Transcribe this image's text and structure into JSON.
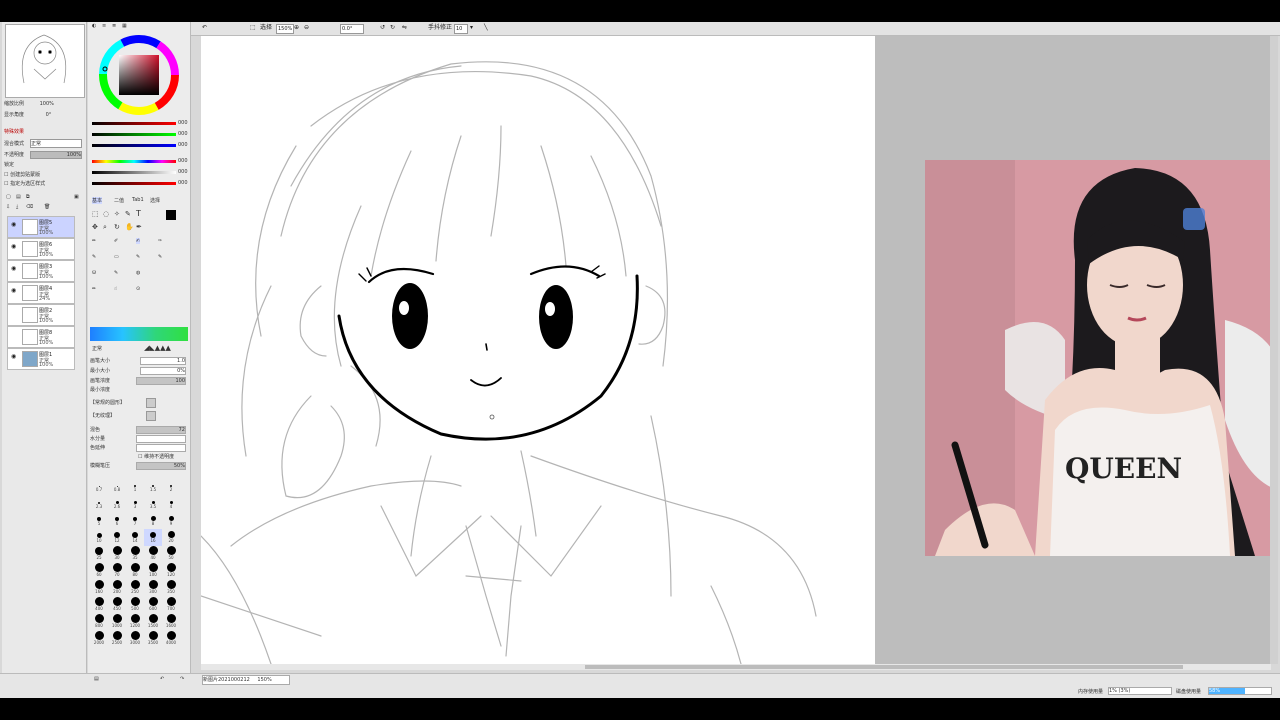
{
  "toolbar": {
    "select_label": "选择",
    "zoom_value": "150%",
    "rotate_value": "0.0°",
    "stabilizer_label": "手抖修正",
    "stabilizer_value": "10"
  },
  "navigator": {
    "zoom_label": "缩放比例",
    "zoom_value": "100%",
    "angle_label": "显示角度",
    "angle_value": "0°"
  },
  "layer_panel": {
    "effects_label": "特殊效果",
    "blend_label": "混合模式",
    "blend_value": "正常",
    "opacity_label": "不透明度",
    "opacity_value": "100%",
    "lock_label": "锁定",
    "clip_label": "创建剪贴蒙版",
    "ref_label": "指定为选区样式",
    "layers": [
      {
        "name": "图层5",
        "mode": "正常",
        "opacity": "100%"
      },
      {
        "name": "图层6",
        "mode": "正常",
        "opacity": "100%"
      },
      {
        "name": "图层3",
        "mode": "正常",
        "opacity": "100%"
      },
      {
        "name": "图层4",
        "mode": "正常",
        "opacity": "24%"
      },
      {
        "name": "图层2",
        "mode": "正常",
        "opacity": "100%"
      },
      {
        "name": "图层8",
        "mode": "正常",
        "opacity": "100%"
      },
      {
        "name": "图层1",
        "mode": "正常",
        "opacity": "100%"
      }
    ]
  },
  "color": {
    "rgb_values": [
      "000",
      "000",
      "000"
    ],
    "hsv_values": [
      "000",
      "000",
      "000"
    ],
    "current": "#000000"
  },
  "tool_panel": {
    "tabs": [
      "基本",
      "二值",
      "Tab1",
      "选择"
    ],
    "mode_value": "正常",
    "brush_size_label": "画笔大小",
    "brush_size_value": "1.0",
    "min_size_label": "最小大小",
    "min_size_value": "0%",
    "density_label": "画笔浓度",
    "density_value": "100",
    "min_density_label": "最小浓度",
    "shape_label": "【常规的圆形】",
    "texture_label": "【无纹理】",
    "mix_label": "混色",
    "mix_value": "72",
    "water_label": "水分量",
    "persistence_label": "色延伸",
    "keep_opacity_label": "维持不透明度",
    "blur_label": "模糊笔压",
    "blur_value": "50%",
    "brush_sizes": [
      "0.7",
      "0.8",
      "1",
      "1.5",
      "2",
      "2.3",
      "2.6",
      "3",
      "3.5",
      "4",
      "5",
      "6",
      "7",
      "8",
      "9",
      "10",
      "12",
      "14",
      "16",
      "20",
      "25",
      "30",
      "35",
      "40",
      "50",
      "60",
      "70",
      "80",
      "100",
      "120",
      "160",
      "200",
      "250",
      "300",
      "350",
      "400",
      "450",
      "500",
      "600",
      "700",
      "800",
      "1000",
      "1200",
      "1500",
      "1600",
      "2000",
      "2500",
      "3000",
      "3500",
      "4000"
    ]
  },
  "status": {
    "file_name": "新图片2021000212",
    "file_zoom": "150%",
    "memory_label": "内存使用量",
    "memory_value": "1% (3%)",
    "disk_label": "磁盘使用量",
    "disk_value": "58%"
  },
  "webcam": {
    "shirt_text": "QUEEN"
  }
}
